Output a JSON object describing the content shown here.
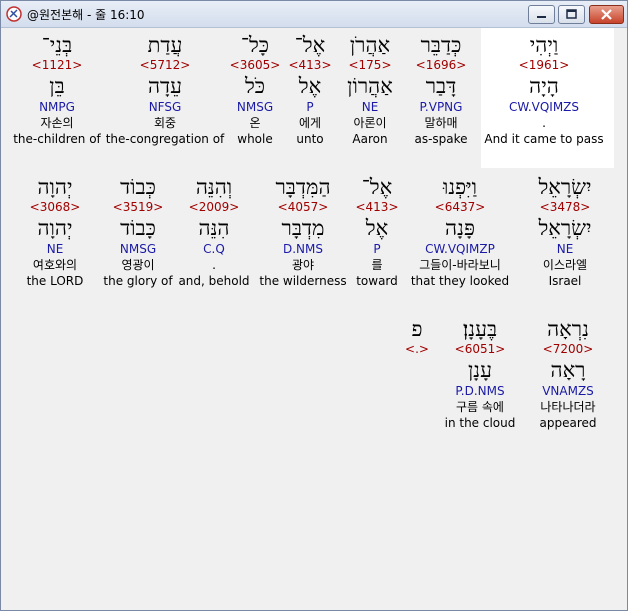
{
  "window": {
    "title": "@원전본해 - 줄 16:10"
  },
  "rows": [
    [
      {
        "heb": "וַיְהִי",
        "strong": "<1961>",
        "lemma": "הָיָה",
        "parse": "CW.VQIMZS",
        "kor": ".",
        "eng": "And it came to pass"
      },
      {
        "heb": "כְּדַבֵּר",
        "strong": "<1696>",
        "lemma": "דָּבַר",
        "parse": "P.VPNG",
        "kor": "말하매",
        "eng": "as-spake"
      },
      {
        "heb": "אַהֲרֹן",
        "strong": "<175>",
        "lemma": "אַהֲרוֹן",
        "parse": "NE",
        "kor": "아론이",
        "eng": "Aaron"
      },
      {
        "heb": "אֶל־",
        "strong": "<413>",
        "lemma": "אֶל",
        "parse": "P",
        "kor": "에게",
        "eng": "unto"
      },
      {
        "heb": "כָּל־",
        "strong": "<3605>",
        "lemma": "כֹּל",
        "parse": "NMSG",
        "kor": "온",
        "eng": "whole"
      },
      {
        "heb": "עֲדַת",
        "strong": "<5712>",
        "lemma": "עֵדָה",
        "parse": "NFSG",
        "kor": "회중",
        "eng": "the-congregation of"
      },
      {
        "heb": "בְּנֵי־",
        "strong": "<1121>",
        "lemma": "בֵּן",
        "parse": "NMPG",
        "kor": "자손의",
        "eng": "the-children of"
      }
    ],
    [
      {
        "heb": "יִשְׂרָאֵל",
        "strong": "<3478>",
        "lemma": "יִשְׂרָאֵל",
        "parse": "NE",
        "kor": "이스라엘",
        "eng": "Israel"
      },
      {
        "heb": "וַיִּפְנוּ",
        "strong": "<6437>",
        "lemma": "פָּנָה",
        "parse": "CW.VQIMZP",
        "kor": "그들이-바라보니",
        "eng": "that they looked"
      },
      {
        "heb": "אֶל־",
        "strong": "<413>",
        "lemma": "אֶל",
        "parse": "P",
        "kor": "를",
        "eng": "toward"
      },
      {
        "heb": "הַמִּדְבָּר",
        "strong": "<4057>",
        "lemma": "מִדְבָּר",
        "parse": "D.NMS",
        "kor": "광야",
        "eng": "the wilderness"
      },
      {
        "heb": "וְהִנֵּה",
        "strong": "<2009>",
        "lemma": "הִנֵּה",
        "parse": "C.Q",
        "kor": ".",
        "eng": "and, behold"
      },
      {
        "heb": "כְּבוֹד",
        "strong": "<3519>",
        "lemma": "כָּבוֹד",
        "parse": "NMSG",
        "kor": "영광이",
        "eng": "the glory of"
      },
      {
        "heb": "יְהוָה",
        "strong": "<3068>",
        "lemma": "יְהוָה",
        "parse": "NE",
        "kor": "여호와의",
        "eng": "the LORD"
      }
    ],
    [
      {
        "heb": "נִרְאָה",
        "strong": "<7200>",
        "lemma": "רָאָה",
        "parse": "VNAMZS",
        "kor": "나타나더라",
        "eng": "appeared"
      },
      {
        "heb": "בֶּעָנָן׃",
        "strong": "<6051>",
        "lemma": "עָנָן",
        "parse": "P.D.NMS",
        "kor": "구름 속에",
        "eng": "in the cloud"
      },
      {
        "heb": "פ",
        "strong": "<.>",
        "lemma": "",
        "parse": "",
        "kor": "",
        "eng": ""
      }
    ]
  ]
}
